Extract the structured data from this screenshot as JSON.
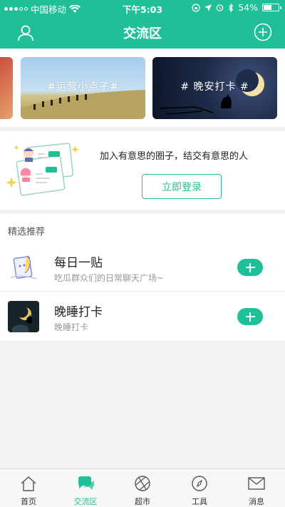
{
  "status_bar": {
    "carrier": "中国移动",
    "time": "下午5:03",
    "battery": "54%",
    "battery_level": 0.54
  },
  "header": {
    "title": "交流区",
    "user_icon": "user-icon",
    "add_icon": "plus-circle-icon"
  },
  "banners": [
    {
      "label": "#运营小点子#"
    },
    {
      "label": "# 晚安打卡 #"
    }
  ],
  "login_prompt": {
    "text": "加入有意思的圈子，结交有意思的人",
    "button": "立即登录"
  },
  "recommend": {
    "title": "精选推荐",
    "items": [
      {
        "name": "每日一贴",
        "desc": "吃瓜群众们的日常聊天广场~"
      },
      {
        "name": "晚睡打卡",
        "desc": "晚睡打卡"
      }
    ]
  },
  "tabs": [
    {
      "label": "首页",
      "icon": "home-icon"
    },
    {
      "label": "交流区",
      "icon": "chat-icon",
      "active": true
    },
    {
      "label": "超市",
      "icon": "aperture-icon"
    },
    {
      "label": "工具",
      "icon": "compass-icon"
    },
    {
      "label": "消息",
      "icon": "mail-icon"
    }
  ],
  "colors": {
    "brand": "#1fbf97"
  }
}
